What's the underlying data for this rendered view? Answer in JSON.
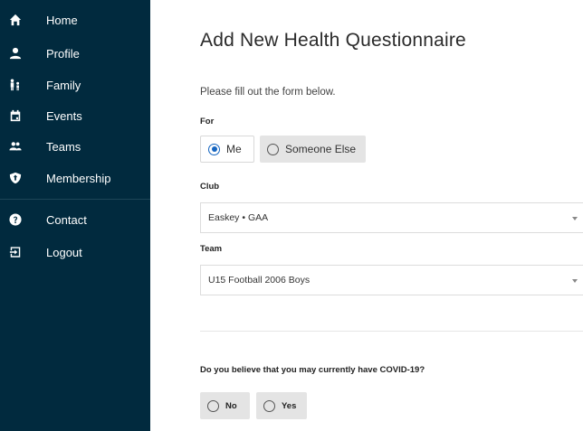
{
  "sidebar": {
    "items": [
      {
        "label": "Home",
        "icon": "home-icon"
      },
      {
        "label": "Profile",
        "icon": "user-icon"
      },
      {
        "label": "Family",
        "icon": "family-icon"
      },
      {
        "label": "Events",
        "icon": "calendar-icon"
      },
      {
        "label": "Teams",
        "icon": "team-icon"
      },
      {
        "label": "Membership",
        "icon": "shield-icon"
      },
      {
        "label": "Contact",
        "icon": "question-icon"
      },
      {
        "label": "Logout",
        "icon": "logout-icon"
      }
    ],
    "background": "#012a3e"
  },
  "main": {
    "title": "Add New Health Questionnaire",
    "intro": "Please fill out the form below.",
    "for_label": "For",
    "for_options": [
      {
        "label": "Me",
        "selected": true
      },
      {
        "label": "Someone Else",
        "selected": false
      }
    ],
    "club_label": "Club",
    "club_value": "Easkey • GAA",
    "team_label": "Team",
    "team_value": "U15 Football 2006 Boys",
    "covid_question": "Do you believe that you may currently have COVID-19?",
    "covid_options": [
      {
        "label": "No",
        "selected": false
      },
      {
        "label": "Yes",
        "selected": false
      }
    ],
    "accent": "#1565c0"
  }
}
